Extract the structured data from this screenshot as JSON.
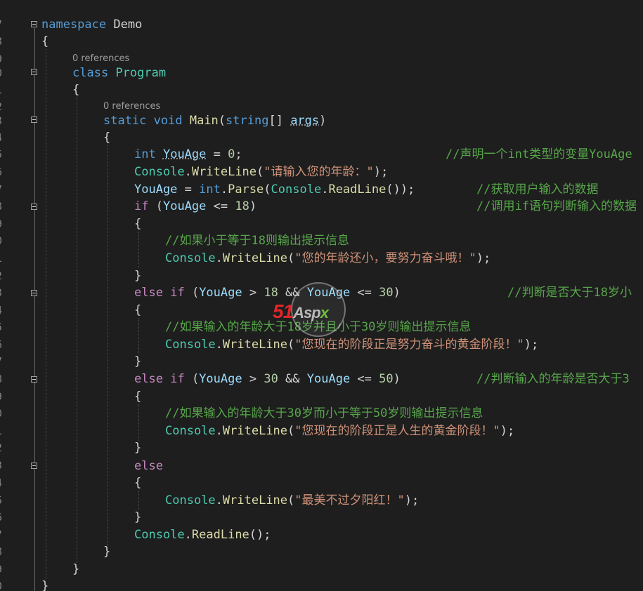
{
  "gutter": {
    "line_fragments": [
      "7",
      "8",
      "9",
      "0",
      "1",
      "2",
      "3",
      "4",
      "5",
      "6",
      "7",
      "8",
      "9",
      "0",
      "1",
      "2",
      "3",
      "4",
      "5",
      "6",
      "7",
      "8",
      "9",
      "0",
      "1",
      "2",
      "3",
      "4",
      "5",
      "6",
      "7",
      "8",
      "9",
      "0",
      "1"
    ]
  },
  "code": {
    "kw_namespace": "namespace",
    "ns_name": " Demo",
    "brace_open": "{",
    "brace_close": "}",
    "ref_class": "0 references",
    "kw_class": "class",
    "class_name": " Program",
    "ref_main": "0 references",
    "kw_static": "static",
    "kw_void": " void",
    "mth_main": " Main",
    "paren_open": "(",
    "kw_string": "string",
    "arr": "[] ",
    "param_args": "args",
    "paren_close": ")",
    "kw_int": "int",
    "var_youage": "YouAge",
    "assign_zero_a": " = ",
    "num_0": "0",
    "semi": ";",
    "cmt_decl": "//声明一个int类型的变量YouAge",
    "cls_console": "Console",
    "dot": ".",
    "mth_writeline": "WriteLine",
    "str_prompt": "\"请输入您的年龄：\"",
    "close_semi": ");",
    "eq": " = ",
    "mth_parse": "Parse",
    "mth_readline": "ReadLine",
    "parse_close": "());",
    "cmt_get": "//获取用户输入的数据",
    "kw_if": "if",
    "le": " <= ",
    "num_18": "18",
    "cmt_if": "//调用if语句判断输入的数据",
    "cmt_if1": "//如果小于等于18则输出提示信息",
    "str_young": "\"您的年龄还小，要努力奋斗哦！\"",
    "kw_else": "else",
    "gt": " > ",
    "and": " && ",
    "num_30": "30",
    "cmt_elseif1": "//判断是否大于18岁小",
    "cmt_if2": "//如果输入的年龄大于18岁并且小于30岁则输出提示信息",
    "str_mid": "\"您现在的阶段正是努力奋斗的黄金阶段！\"",
    "num_50": "50",
    "cmt_elseif2": "//判断输入的年龄是否大于3",
    "cmt_if3": "//如果输入的年龄大于30岁而小于等于50岁则输出提示信息",
    "str_gold": "\"您现在的阶段正是人生的黄金阶段！\"",
    "str_sunset": "\"最美不过夕阳红！\"",
    "readline_end": "();"
  },
  "watermark": {
    "part1": "51",
    "part2": "Asp",
    "part3": "x"
  },
  "colors": {
    "background": "#1e1e1e",
    "keyword": "#569cd6",
    "control": "#c586c0",
    "type": "#4ec9b0",
    "method": "#dcdcaa",
    "variable": "#9cdcfe",
    "number": "#b5cea8",
    "string": "#ce9178",
    "comment": "#57a64a"
  }
}
